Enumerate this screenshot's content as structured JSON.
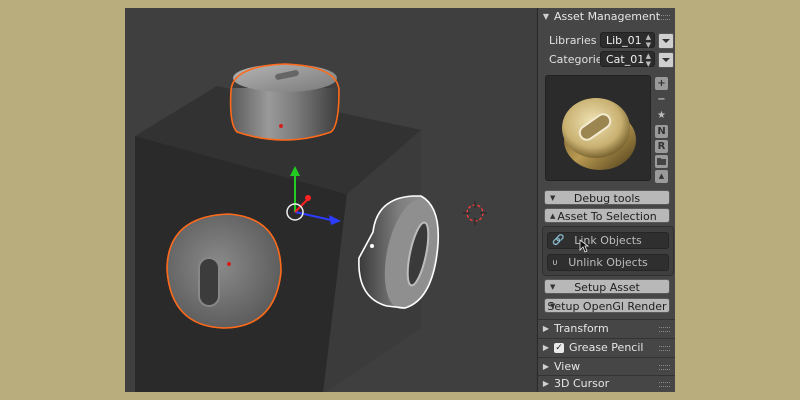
{
  "panel": {
    "title": "Asset Management",
    "libraries_label": "Libraries",
    "libraries_value": "Lib_01",
    "categories_label": "Categories",
    "categories_value": "Cat_01",
    "side_icons": [
      "+",
      "−",
      "★",
      "N",
      "R"
    ],
    "debug_tools": "Debug tools",
    "asset_to_selection": "Asset To Selection",
    "link_objects": "Link Objects",
    "unlink_objects": "Unlink Objects",
    "setup_asset": "Setup Asset",
    "setup_opengl": "Setup OpenGl Render",
    "sections": [
      "Transform",
      "Grease Pencil",
      "View",
      "3D Cursor"
    ]
  },
  "colors": {
    "selection_outline": "#ff6a1a",
    "active_outline": "#ffffff",
    "axis_x": "#2c3cff",
    "axis_y": "#22cc22",
    "axis_z": "#ff2222",
    "asset_gold": "#d8c486"
  },
  "icons": {
    "link": "chain-link-icon",
    "unlink": "broken-link-icon",
    "collapse": "triangle-icon",
    "cursor": "3d-cursor-icon",
    "mouse": "mouse-pointer-icon"
  }
}
